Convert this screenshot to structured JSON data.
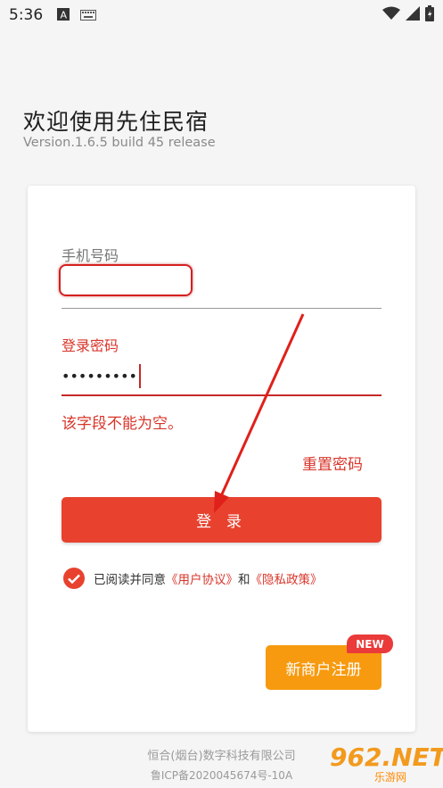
{
  "status": {
    "time": "5:36"
  },
  "header": {
    "title": "欢迎使用先住民宿",
    "version": "Version.1.6.5 build 45 release"
  },
  "form": {
    "phone_label": "手机号码",
    "phone_value": "",
    "password_label": "登录密码",
    "password_value": "•••••••••",
    "error_text": "该字段不能为空。",
    "reset_link": "重置密码",
    "login_button": "登 录",
    "agreement": {
      "prefix": "已阅读并同意",
      "user_agreement": "《用户协议》",
      "and": "和",
      "privacy_policy": "《隐私政策》",
      "checked": true
    },
    "register_button": "新商户注册",
    "new_badge": "NEW"
  },
  "footer": {
    "company": "恒合(烟台)数字科技有限公司",
    "icp": "鲁ICP备2020045674号-10A"
  },
  "watermark": {
    "main": "962.NET",
    "sub": "乐游网"
  },
  "colors": {
    "accent": "#e8422f",
    "orange": "#f79a0f",
    "error": "#d8352a"
  }
}
